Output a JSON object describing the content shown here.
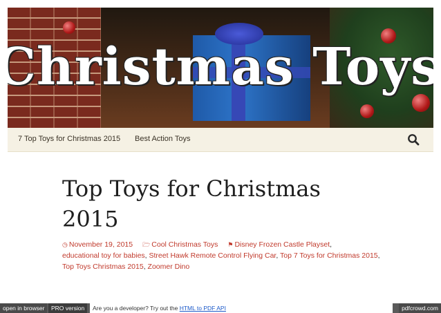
{
  "banner": {
    "title": "Christmas Toys"
  },
  "nav": {
    "items": [
      {
        "label": "7 Top Toys for Christmas 2015"
      },
      {
        "label": "Best Action Toys"
      }
    ],
    "search_icon": "search-icon"
  },
  "post": {
    "title": "Top Toys for Christmas 2015",
    "date": "November 19, 2015",
    "category": "Cool Christmas Toys",
    "tags": [
      "Disney Frozen Castle Playset",
      "educational toy for babies",
      "Street Hawk Remote Control Flying Car",
      "Top 7 Toys for Christmas 2015",
      "Top Toys Christmas 2015",
      "Zoomer Dino"
    ],
    "icons": {
      "date": "clock-icon",
      "category": "folder-icon",
      "tags": "tag-icon"
    }
  },
  "footer": {
    "open_browser": "open in browser",
    "pro_version": "PRO version",
    "dev_text": "Are you a developer? Try out the",
    "dev_link": "HTML to PDF API",
    "brand": "pdfcrowd.com"
  },
  "colors": {
    "accent": "#c0392b",
    "nav_bg": "#f5f1e4",
    "footer_bg": "#5a5a5a"
  }
}
